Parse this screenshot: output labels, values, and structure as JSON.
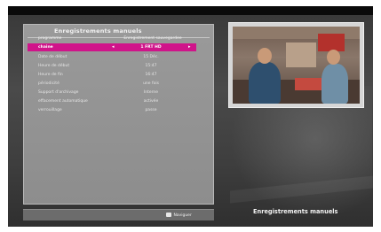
{
  "panel": {
    "title": "Enregistrements manuels"
  },
  "header_row": {
    "label": "programme",
    "value": "Enregistrement sauvegardee"
  },
  "rows": [
    {
      "label": "chaine",
      "value": "1 FRT HD",
      "selected": true
    },
    {
      "label": "Date de début",
      "value": "15 Déc.",
      "selected": false
    },
    {
      "label": "Heure de début",
      "value": "15:47",
      "selected": false
    },
    {
      "label": "Heure de fin",
      "value": "16:47",
      "selected": false
    },
    {
      "label": "périodicité",
      "value": "une fois",
      "selected": false
    },
    {
      "label": "Support d'archivage",
      "value": "Interne",
      "selected": false
    },
    {
      "label": "effacement automatique",
      "value": "activée",
      "selected": false
    },
    {
      "label": "verrouillage",
      "value": "passe",
      "selected": false
    }
  ],
  "selection_arrows": {
    "left": "◂",
    "right": "▸"
  },
  "bottom_bar": {
    "nav_label": "Naviguer",
    "nav_icon": "navigate-icon"
  },
  "footer": {
    "title": "Enregistrements manuels"
  },
  "colors": {
    "highlight": "#d0148a",
    "panel": "#9a9a9a",
    "background": "#3e3e3e"
  }
}
